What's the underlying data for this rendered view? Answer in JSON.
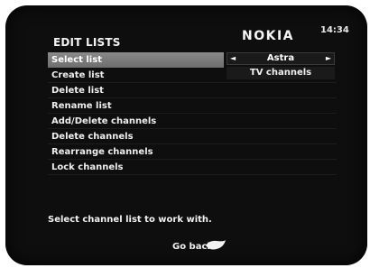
{
  "header": {
    "title": "EDIT LISTS",
    "brand": "NOKIA",
    "time": "14:34"
  },
  "menu": {
    "items": [
      {
        "label": "Select list",
        "selected": true
      },
      {
        "label": "Create list",
        "selected": false
      },
      {
        "label": "Delete list",
        "selected": false
      },
      {
        "label": "Rename list",
        "selected": false
      },
      {
        "label": "Add/Delete channels",
        "selected": false
      },
      {
        "label": "Delete channels",
        "selected": false
      },
      {
        "label": "Rearrange channels",
        "selected": false
      },
      {
        "label": "Lock channels",
        "selected": false
      }
    ]
  },
  "selector": {
    "value": "Astra",
    "left_arrow": "◄",
    "right_arrow": "►",
    "dropdown_option": "TV channels"
  },
  "footer": {
    "help_text": "Select channel list to work with.",
    "back_label": "Go back",
    "back_icon": "remote-back-icon"
  },
  "colors": {
    "screen_bg": "#0e0e0e",
    "highlight": "#7c7c7c",
    "text": "#efefef"
  }
}
